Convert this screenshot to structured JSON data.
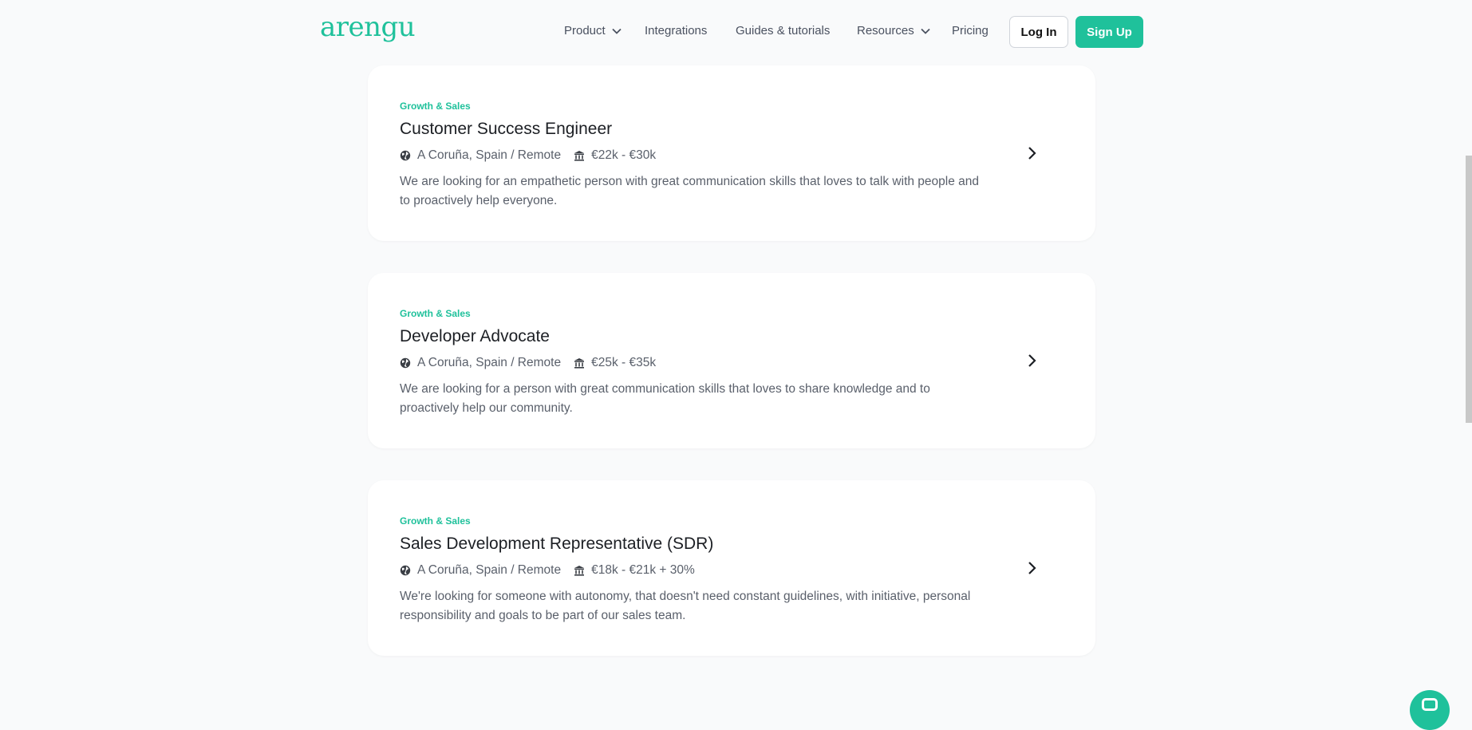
{
  "brand": {
    "logo": "arengu",
    "accent_color": "#1fc19b"
  },
  "nav": {
    "product": "Product",
    "integrations": "Integrations",
    "guides": "Guides & tutorials",
    "resources": "Resources",
    "pricing": "Pricing",
    "login": "Log In",
    "signup": "Sign Up"
  },
  "jobs": [
    {
      "category": "Growth & Sales",
      "title": "Customer Success Engineer",
      "location": "A Coruña, Spain / Remote",
      "salary": "€22k - €30k",
      "description": "We are looking for an empathetic person with great communication skills that loves to talk with people and to proactively help everyone."
    },
    {
      "category": "Growth & Sales",
      "title": "Developer Advocate",
      "location": "A Coruña, Spain / Remote",
      "salary": "€25k - €35k",
      "description": "We are looking for a person with great communication skills that loves to share knowledge and to proactively help our community."
    },
    {
      "category": "Growth & Sales",
      "title": "Sales Development Representative (SDR)",
      "location": "A Coruña, Spain / Remote",
      "salary": "€18k - €21k + 30%",
      "description": "We're looking for someone with autonomy, that doesn't need constant guidelines, with initiative, personal responsibility and goals to be part of our sales team."
    }
  ],
  "icons": {
    "location": "globe-icon",
    "salary": "bank-icon",
    "open": "chevron-right-icon",
    "chat": "chat-icon"
  }
}
